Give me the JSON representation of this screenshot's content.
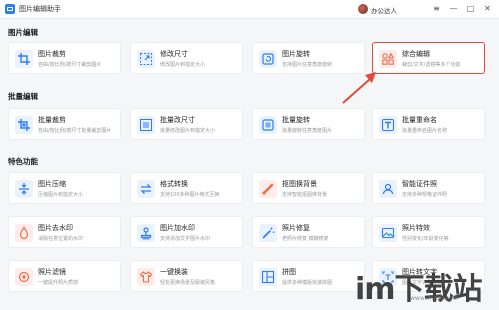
{
  "app": {
    "title": "图片编辑助手",
    "user_name": "办公达人"
  },
  "window_controls": {
    "menu": "≡",
    "minimize": "—",
    "maximize": "□",
    "close": "✕"
  },
  "sections": {
    "edit": "图片编辑",
    "batch": "批量编辑",
    "special": "特色功能"
  },
  "colors": {
    "accent": "#2f7cf6",
    "highlight_border": "#e24a3b",
    "arrow": "#e24a3b",
    "icon_bg": "#eaf2fe",
    "icon_red_bg": "#fdecea"
  },
  "edit_tools": [
    {
      "title": "图片裁剪",
      "desc": "自由/按比例/按尺寸裁剪图片",
      "icon": "crop-icon"
    },
    {
      "title": "修改尺寸",
      "desc": "修改图片到指定大小",
      "icon": "resize-icon"
    },
    {
      "title": "图片旋转",
      "desc": "支持图片任意角度旋转",
      "icon": "rotate-icon"
    },
    {
      "title": "综合编辑",
      "desc": "裁剪/文字/滤镜等多个功能",
      "icon": "grid-edit-icon"
    }
  ],
  "batch_tools": [
    {
      "title": "批量裁剪",
      "desc": "自由/按比例/按尺寸批量裁剪图片",
      "icon": "batch-crop-icon"
    },
    {
      "title": "批量改尺寸",
      "desc": "批量修改图片到指定大小",
      "icon": "batch-resize-icon"
    },
    {
      "title": "批量旋转",
      "desc": "批量旋转任意角度图片",
      "icon": "batch-rotate-icon"
    },
    {
      "title": "批量重命名",
      "desc": "批量重命名图片名称",
      "icon": "text-t-icon"
    }
  ],
  "special_tools": [
    {
      "title": "图片压缩",
      "desc": "压缩图片到指定大小",
      "icon": "compress-icon"
    },
    {
      "title": "格式转换",
      "desc": "支持100多种图片格式互换",
      "icon": "convert-icon"
    },
    {
      "title": "抠图换背景",
      "desc": "支持智能抠图换背景",
      "icon": "cutout-icon"
    },
    {
      "title": "智能证件照",
      "desc": "支持多种规格证件照",
      "icon": "id-photo-icon"
    },
    {
      "title": "图片去水印",
      "desc": "消除任意位置的水印",
      "icon": "remove-watermark-icon"
    },
    {
      "title": "图片加水印",
      "desc": "支持添加文字图片水印",
      "icon": "stamp-icon"
    },
    {
      "title": "照片修复",
      "desc": "老照片修复 模糊修复",
      "icon": "magic-wand-icon"
    },
    {
      "title": "照片特效",
      "desc": "性别变化/年龄变化等",
      "icon": "photo-effect-icon"
    },
    {
      "title": "照片滤镜",
      "desc": "一键提升照片质感",
      "icon": "filter-icon"
    },
    {
      "title": "一键换装",
      "desc": "轻松更换场景及服装风格",
      "icon": "outfit-icon"
    },
    {
      "title": "拼图",
      "desc": "提供多种模版快速拼图",
      "icon": "collage-icon"
    },
    {
      "title": "图片转文字",
      "desc": "图片文字识别提取",
      "icon": "ocr-icon"
    }
  ],
  "watermark": {
    "text": "im下载站",
    "sub": "www.imday.com"
  }
}
